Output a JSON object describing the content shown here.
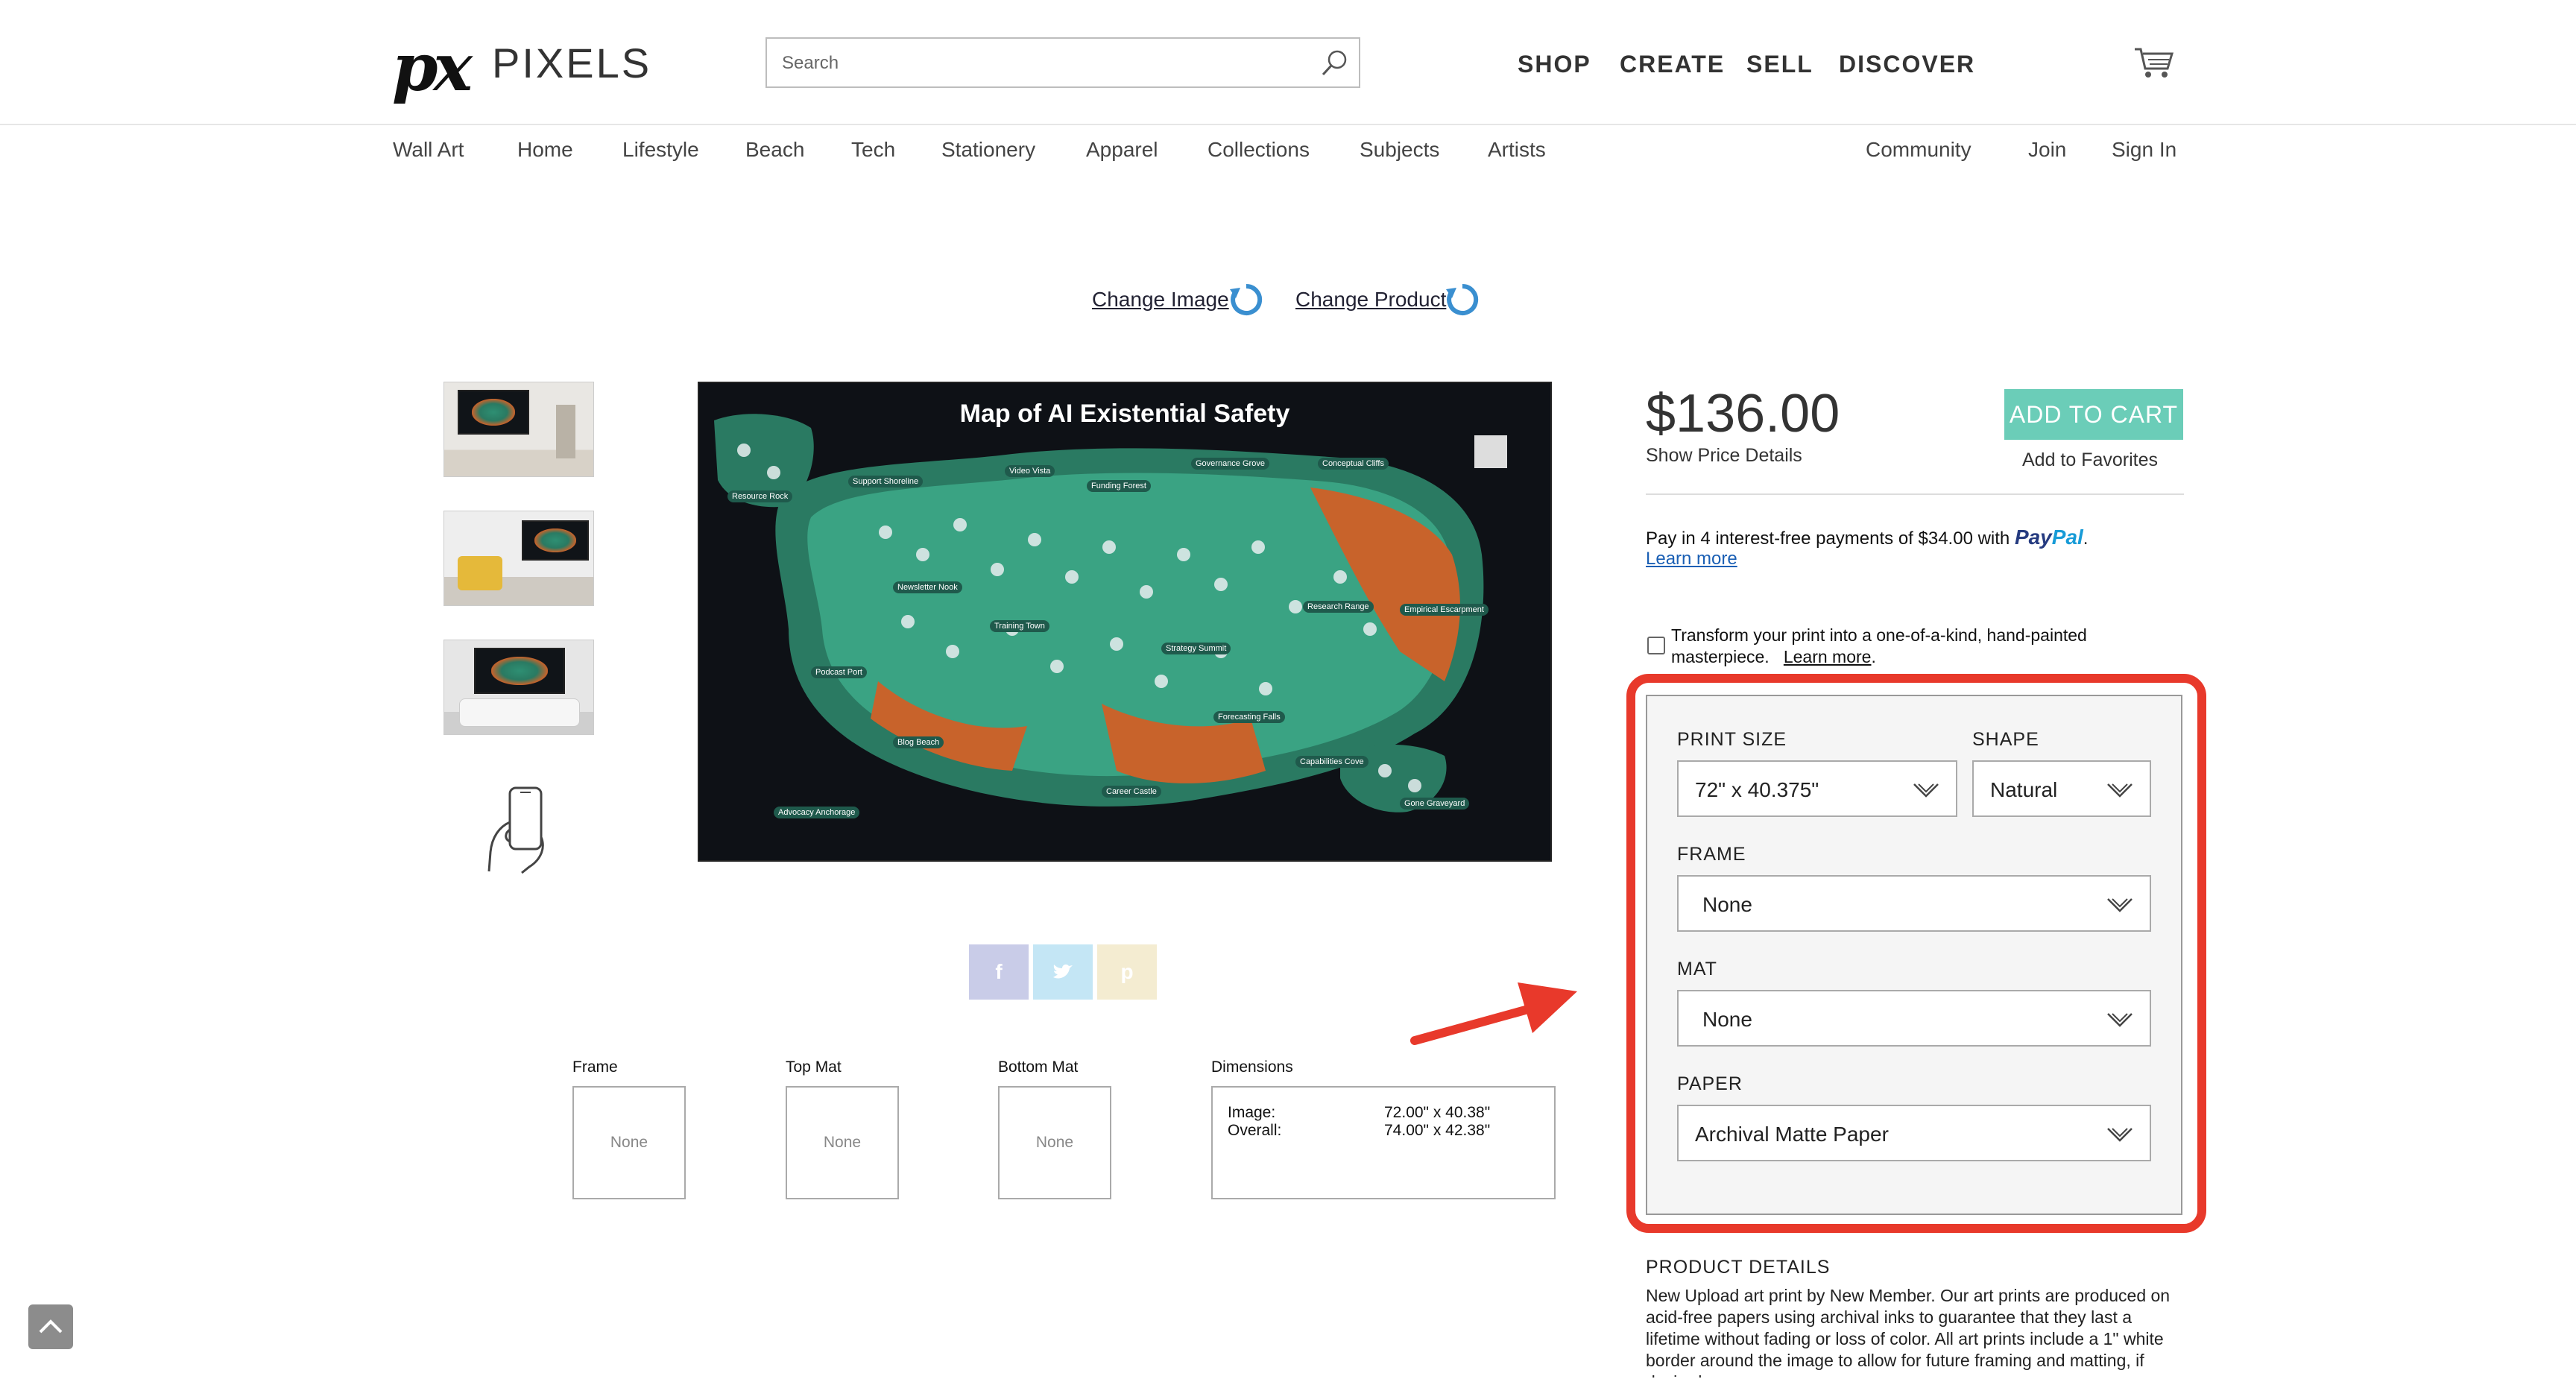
{
  "header": {
    "logo_mark": "px",
    "logo_text": "PIXELS",
    "search_placeholder": "Search",
    "nav": [
      "SHOP",
      "CREATE",
      "SELL",
      "DISCOVER"
    ]
  },
  "categories": [
    "Wall Art",
    "Home",
    "Lifestyle",
    "Beach",
    "Tech",
    "Stationery",
    "Apparel",
    "Collections",
    "Subjects",
    "Artists"
  ],
  "account_links": [
    "Community",
    "Join",
    "Sign In"
  ],
  "change_links": {
    "image": "Change Image",
    "product": "Change Product"
  },
  "artwork": {
    "title": "Map of AI Existential Safety",
    "regions": [
      "Support Shoreline",
      "Video Vista",
      "Funding Forest",
      "Governance Grove",
      "Conceptual Cliffs",
      "Resource Rock",
      "Newsletter Nook",
      "Training Town",
      "Research Range",
      "Empirical Escarpment",
      "Strategy Summit",
      "Podcast Port",
      "Forecasting Falls",
      "Blog Beach",
      "Capabilities Cove",
      "Career Castle",
      "Advocacy Anchorage",
      "Gone Graveyard"
    ]
  },
  "components": {
    "frame_label": "Frame",
    "frame_value": "None",
    "top_mat_label": "Top Mat",
    "top_mat_value": "None",
    "bottom_mat_label": "Bottom Mat",
    "bottom_mat_value": "None",
    "dimensions_label": "Dimensions",
    "image_label": "Image:",
    "image_value": "72.00\" x 40.38\"",
    "overall_label": "Overall:",
    "overall_value": "74.00\" x 42.38\""
  },
  "product": {
    "price": "$136.00",
    "show_price_details": "Show Price Details",
    "add_to_cart": "ADD TO CART",
    "add_to_favorites": "Add to Favorites",
    "paypal_text": "Pay in 4 interest-free payments of $34.00 with",
    "paypal_brand_a": "Pay",
    "paypal_brand_b": "Pal",
    "learn_more": "Learn more",
    "transform_text": "Transform your print into a one-of-a-kind, hand-painted masterpiece.",
    "transform_learn_more": "Learn more"
  },
  "options": {
    "print_size_label": "PRINT SIZE",
    "print_size_value": "72\" x 40.375\"",
    "shape_label": "SHAPE",
    "shape_value": "Natural",
    "frame_label": "FRAME",
    "frame_value": "None",
    "mat_label": "MAT",
    "mat_value": "None",
    "paper_label": "PAPER",
    "paper_value": "Archival Matte Paper"
  },
  "details": {
    "title": "PRODUCT DETAILS",
    "text": "New Upload art print by New Member.   Our art prints are produced on acid-free papers using archival inks to guarantee that they last a lifetime without fading or loss of color. All art prints include a 1\" white border around the image to allow for future framing and matting, if desired."
  },
  "colors": {
    "accent_button": "#6bcdb8",
    "highlight": "#e8392b",
    "map_green": "#2e8f73",
    "map_orange": "#c8632b"
  }
}
